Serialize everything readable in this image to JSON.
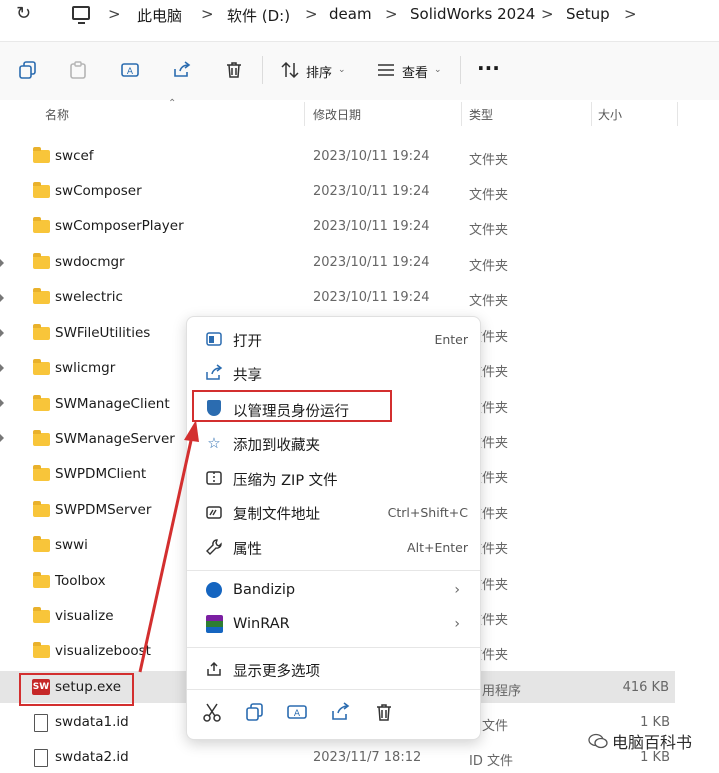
{
  "address_bar": {
    "refresh_icon": "refresh-icon",
    "computer_icon": "computer-icon",
    "breadcrumbs": [
      "此电脑",
      "软件 (D:)",
      "deam",
      "SolidWorks 2024",
      "Setup"
    ],
    "separator": ">"
  },
  "toolbar": {
    "icons": [
      "copy-icon",
      "paste-icon",
      "rename-icon",
      "share-icon",
      "delete-icon"
    ],
    "sort_label": "排序",
    "view_label": "查看",
    "more": "···"
  },
  "columns": {
    "name": "名称",
    "modified": "修改日期",
    "type": "类型",
    "size": "大小"
  },
  "files": [
    {
      "name": "swcef",
      "date": "2023/10/11 19:24",
      "type": "文件夹",
      "size": "",
      "kind": "folder"
    },
    {
      "name": "swComposer",
      "date": "2023/10/11 19:24",
      "type": "文件夹",
      "size": "",
      "kind": "folder"
    },
    {
      "name": "swComposerPlayer",
      "date": "2023/10/11 19:24",
      "type": "文件夹",
      "size": "",
      "kind": "folder"
    },
    {
      "name": "swdocmgr",
      "date": "2023/10/11 19:24",
      "type": "文件夹",
      "size": "",
      "kind": "folder"
    },
    {
      "name": "swelectric",
      "date": "2023/10/11 19:24",
      "type": "文件夹",
      "size": "",
      "kind": "folder"
    },
    {
      "name": "SWFileUtilities",
      "date": "",
      "type": "文件夹",
      "size": "",
      "kind": "folder"
    },
    {
      "name": "swlicmgr",
      "date": "",
      "type": "文件夹",
      "size": "",
      "kind": "folder"
    },
    {
      "name": "SWManageClient",
      "date": "",
      "type": "文件夹",
      "size": "",
      "kind": "folder"
    },
    {
      "name": "SWManageServer",
      "date": "",
      "type": "文件夹",
      "size": "",
      "kind": "folder"
    },
    {
      "name": "SWPDMClient",
      "date": "",
      "type": "文件夹",
      "size": "",
      "kind": "folder"
    },
    {
      "name": "SWPDMServer",
      "date": "",
      "type": "文件夹",
      "size": "",
      "kind": "folder"
    },
    {
      "name": "swwi",
      "date": "",
      "type": "文件夹",
      "size": "",
      "kind": "folder"
    },
    {
      "name": "Toolbox",
      "date": "",
      "type": "文件夹",
      "size": "",
      "kind": "folder"
    },
    {
      "name": "visualize",
      "date": "",
      "type": "文件夹",
      "size": "",
      "kind": "folder"
    },
    {
      "name": "visualizeboost",
      "date": "",
      "type": "文件夹",
      "size": "",
      "kind": "folder"
    },
    {
      "name": "setup.exe",
      "date": "",
      "type": "用程序",
      "size": "416 KB",
      "kind": "exe"
    },
    {
      "name": "swdata1.id",
      "date": "",
      "type": "文件",
      "size": "1 KB",
      "kind": "file"
    },
    {
      "name": "swdata2.id",
      "date": "2023/11/7 18:12",
      "type": "ID 文件",
      "size": "1 KB",
      "kind": "file"
    }
  ],
  "context_menu": {
    "items": [
      {
        "label": "打开",
        "shortcut": "Enter",
        "icon": "open-icon"
      },
      {
        "label": "共享",
        "shortcut": "",
        "icon": "share-icon"
      },
      {
        "label": "以管理员身份运行",
        "shortcut": "",
        "icon": "admin-shield-icon"
      },
      {
        "label": "添加到收藏夹",
        "shortcut": "",
        "icon": "star-icon"
      },
      {
        "label": "压缩为 ZIP 文件",
        "shortcut": "",
        "icon": "zip-icon"
      },
      {
        "label": "复制文件地址",
        "shortcut": "Ctrl+Shift+C",
        "icon": "copy-path-icon"
      },
      {
        "label": "属性",
        "shortcut": "Alt+Enter",
        "icon": "wrench-icon"
      },
      {
        "label": "Bandizip",
        "shortcut": "",
        "icon": "bandizip-icon"
      },
      {
        "label": "WinRAR",
        "shortcut": "",
        "icon": "winrar-icon"
      },
      {
        "label": "显示更多选项",
        "shortcut": "",
        "icon": "more-options-icon"
      }
    ],
    "submenu_arrow": "›",
    "bottom_icons": [
      "cut-icon",
      "copy-icon",
      "rename-icon",
      "share-icon",
      "delete-icon"
    ]
  },
  "watermark": {
    "text": "电脑百科书"
  },
  "colors": {
    "accent": "#2b6cb0",
    "annotation_red": "#d32f2f",
    "folder": "#f8c53a"
  }
}
